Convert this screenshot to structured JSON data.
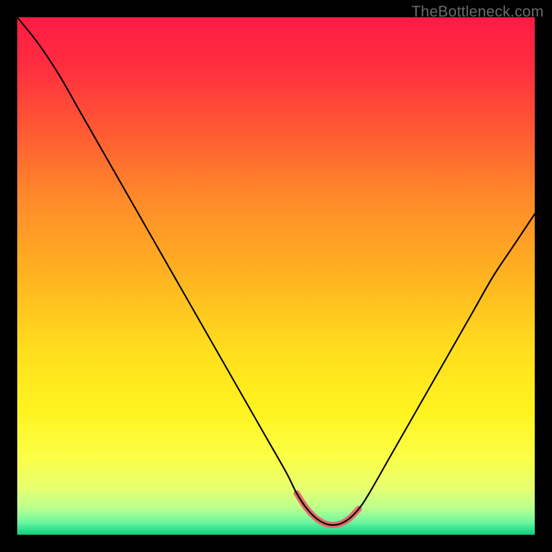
{
  "watermark": "TheBottleneck.com",
  "chart_data": {
    "type": "line",
    "title": "",
    "xlabel": "",
    "ylabel": "",
    "xlim": [
      0,
      100
    ],
    "ylim": [
      0,
      100
    ],
    "grid": false,
    "series": [
      {
        "name": "bottleneck-curve",
        "x": [
          0,
          4,
          8,
          12,
          16,
          20,
          24,
          28,
          32,
          36,
          40,
          44,
          48,
          52,
          54,
          56,
          58,
          60,
          62,
          64,
          66,
          68,
          72,
          76,
          80,
          84,
          88,
          92,
          96,
          100
        ],
        "y": [
          100,
          95,
          89,
          82,
          75,
          68,
          61,
          54,
          47,
          40,
          33,
          26,
          19,
          12,
          8,
          5,
          3,
          2,
          2,
          3,
          5,
          8,
          15,
          22,
          29,
          36,
          43,
          50,
          56,
          62
        ]
      }
    ],
    "annotations": [
      {
        "name": "min-highlight",
        "type": "segment",
        "x": [
          54,
          56,
          58,
          60,
          62,
          64,
          66
        ],
        "y": [
          8,
          5,
          3,
          2,
          2,
          3,
          5
        ],
        "color": "#e46a6a",
        "stroke_width": 9
      }
    ],
    "background_gradient": {
      "stops": [
        {
          "offset": 0.0,
          "color": "#ff1a44"
        },
        {
          "offset": 0.1,
          "color": "#ff2f3f"
        },
        {
          "offset": 0.22,
          "color": "#ff5a33"
        },
        {
          "offset": 0.35,
          "color": "#ff8a2a"
        },
        {
          "offset": 0.5,
          "color": "#ffb321"
        },
        {
          "offset": 0.64,
          "color": "#ffdd1e"
        },
        {
          "offset": 0.76,
          "color": "#fff31f"
        },
        {
          "offset": 0.85,
          "color": "#fbff46"
        },
        {
          "offset": 0.91,
          "color": "#e7ff6f"
        },
        {
          "offset": 0.95,
          "color": "#b7ff8f"
        },
        {
          "offset": 0.975,
          "color": "#70f7a0"
        },
        {
          "offset": 0.99,
          "color": "#2fe28f"
        },
        {
          "offset": 1.0,
          "color": "#14c97a"
        }
      ]
    }
  }
}
